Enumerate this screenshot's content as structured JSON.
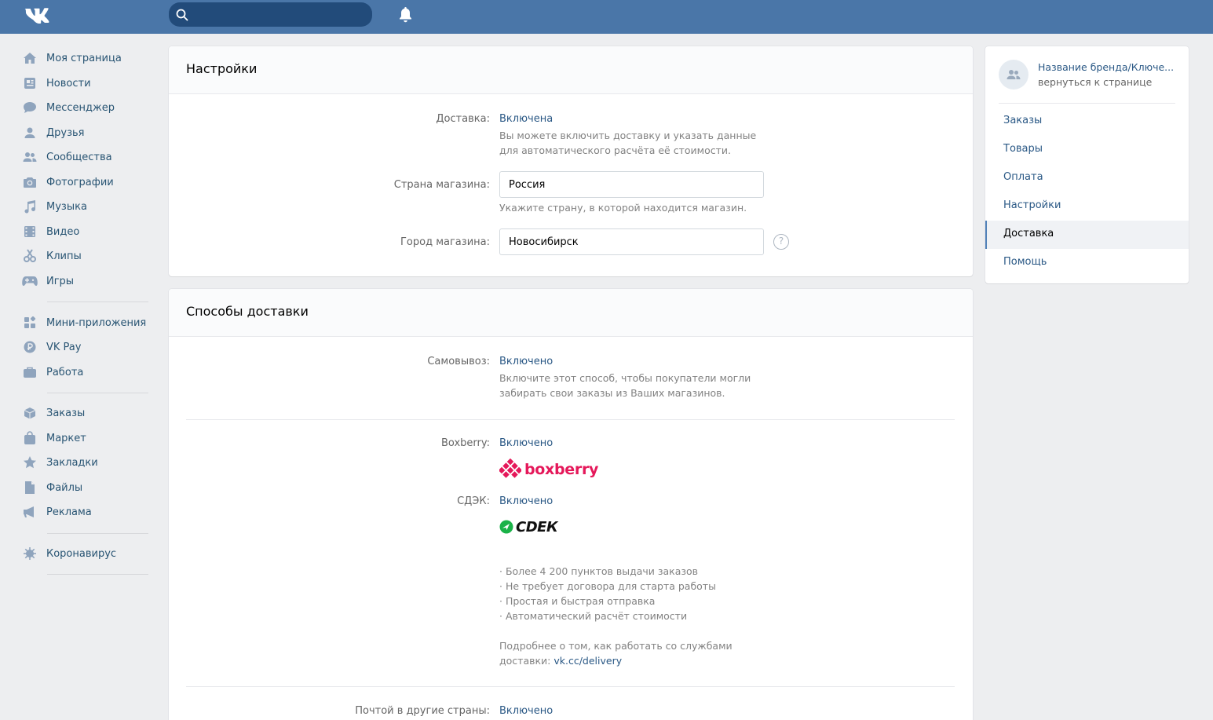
{
  "header": {
    "logo": "vk-logo",
    "search_placeholder": "",
    "bell": "bell-icon"
  },
  "leftnav": {
    "groups": [
      [
        {
          "label": "Моя страница",
          "icon": "home-icon"
        },
        {
          "label": "Новости",
          "icon": "news-icon"
        },
        {
          "label": "Мессенджер",
          "icon": "messenger-icon"
        },
        {
          "label": "Друзья",
          "icon": "friends-icon"
        },
        {
          "label": "Сообщества",
          "icon": "communities-icon"
        },
        {
          "label": "Фотографии",
          "icon": "camera-icon"
        },
        {
          "label": "Музыка",
          "icon": "music-icon"
        },
        {
          "label": "Видео",
          "icon": "video-icon"
        },
        {
          "label": "Клипы",
          "icon": "clips-icon"
        },
        {
          "label": "Игры",
          "icon": "gamepad-icon"
        }
      ],
      [
        {
          "label": "Мини-приложения",
          "icon": "apps-icon"
        },
        {
          "label": "VK Pay",
          "icon": "vkpay-icon"
        },
        {
          "label": "Работа",
          "icon": "briefcase-icon"
        }
      ],
      [
        {
          "label": "Заказы",
          "icon": "box-icon"
        },
        {
          "label": "Маркет",
          "icon": "bag-icon"
        },
        {
          "label": "Закладки",
          "icon": "star-icon"
        },
        {
          "label": "Файлы",
          "icon": "file-icon"
        },
        {
          "label": "Реклама",
          "icon": "megaphone-icon"
        }
      ],
      [
        {
          "label": "Коронавирус",
          "icon": "virus-icon"
        }
      ]
    ]
  },
  "settings": {
    "title": "Настройки",
    "delivery": {
      "label": "Доставка:",
      "value": "Включена",
      "hint1": "Вы можете включить доставку и указать данные",
      "hint2": "для автоматического расчёта её стоимости."
    },
    "country": {
      "label": "Страна магазина:",
      "value": "Россия",
      "hint": "Укажите страну, в которой находится магазин."
    },
    "city": {
      "label": "Город магазина:",
      "value": "Новосибирск",
      "help": "?"
    }
  },
  "methods": {
    "title": "Способы доставки",
    "pickup": {
      "label": "Самовывоз:",
      "value": "Включено",
      "hint1": "Включите этот способ, чтобы покупатели могли",
      "hint2": "забирать свои заказы из Ваших магазинов."
    },
    "boxberry": {
      "label": "Boxberry:",
      "value": "Включено",
      "logo_text": "boxberry"
    },
    "cdek": {
      "label": "СДЭК:",
      "value": "Включено",
      "logo_text": "СDЕК"
    },
    "features": [
      "· Более 4 200 пунктов выдачи заказов",
      "· Не требует договора для старта работы",
      "· Простая и быстрая отправка",
      "· Автоматический расчёт стоимости"
    ],
    "more1": "Подробнее о том, как работать со службами",
    "more2_prefix": "доставки: ",
    "more2_link": "vk.cc/delivery",
    "intl": {
      "label": "Почтой в другие страны:",
      "value": "Включено"
    }
  },
  "rightmenu": {
    "brand_name": "Название бренда/Ключе...",
    "brand_back": "вернуться к странице",
    "items": [
      "Заказы",
      "Товары",
      "Оплата",
      "Настройки",
      "Доставка",
      "Помощь"
    ],
    "active": "Доставка"
  },
  "colors": {
    "header": "#4a76a8",
    "link": "#2a5885",
    "boxberry": "#e5185a",
    "cdek": "#1ab248"
  }
}
